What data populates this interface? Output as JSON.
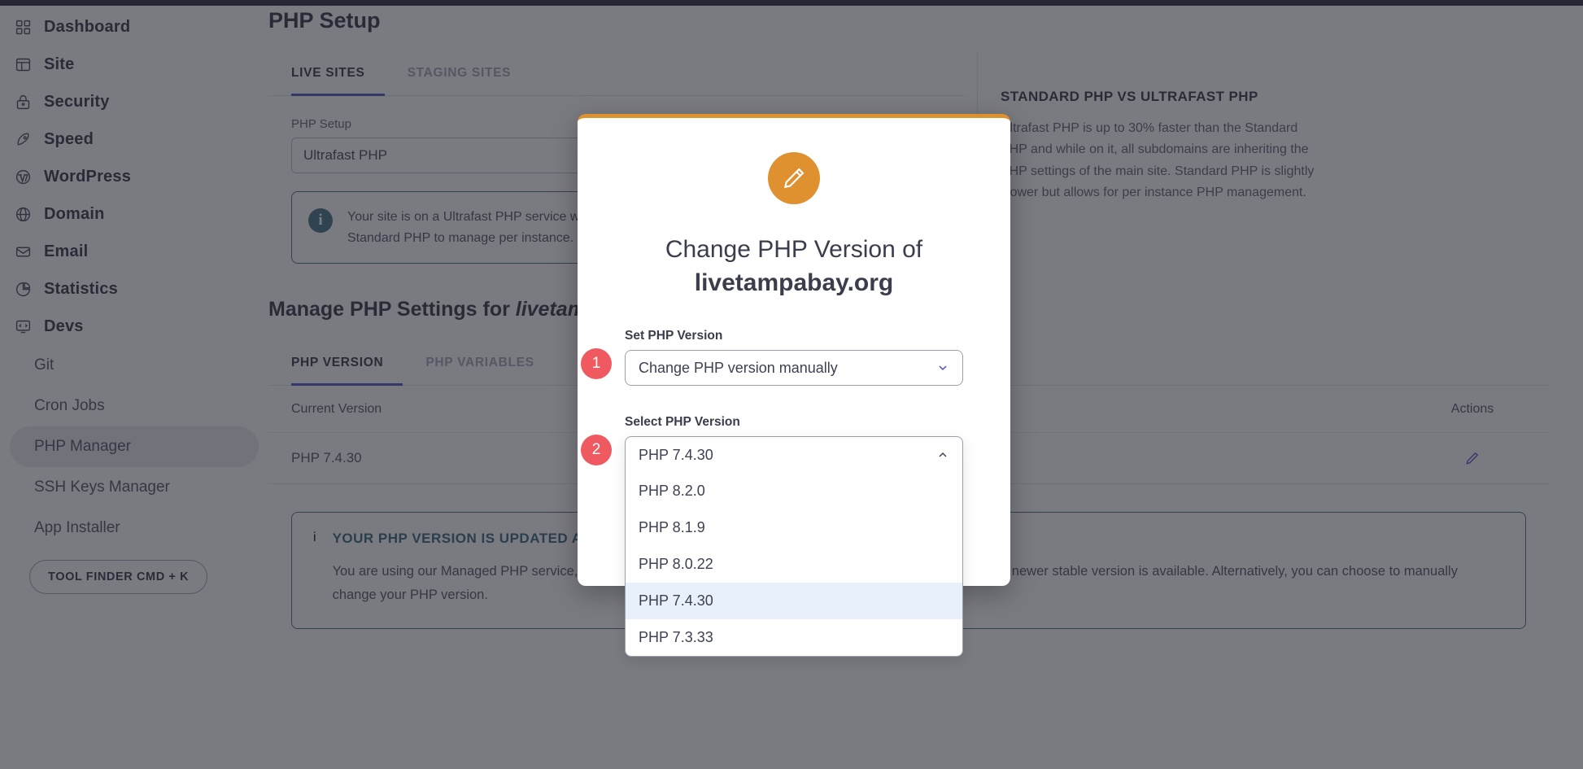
{
  "sidebar": {
    "items": [
      {
        "label": "Dashboard",
        "icon": "grid-icon",
        "type": "main"
      },
      {
        "label": "Site",
        "icon": "site-icon",
        "type": "main"
      },
      {
        "label": "Security",
        "icon": "lock-icon",
        "type": "main"
      },
      {
        "label": "Speed",
        "icon": "rocket-icon",
        "type": "main"
      },
      {
        "label": "WordPress",
        "icon": "wordpress-icon",
        "type": "main"
      },
      {
        "label": "Domain",
        "icon": "globe-icon",
        "type": "main"
      },
      {
        "label": "Email",
        "icon": "envelope-icon",
        "type": "main"
      },
      {
        "label": "Statistics",
        "icon": "pie-chart-icon",
        "type": "main"
      },
      {
        "label": "Devs",
        "icon": "code-monitor-icon",
        "type": "main"
      }
    ],
    "sub_items": [
      {
        "label": "Git",
        "active": false
      },
      {
        "label": "Cron Jobs",
        "active": false
      },
      {
        "label": "PHP Manager",
        "active": true
      },
      {
        "label": "SSH Keys Manager",
        "active": false
      },
      {
        "label": "App Installer",
        "active": false
      }
    ],
    "tool_finder_label": "TOOL FINDER CMD + K"
  },
  "main": {
    "page_title": "PHP Setup",
    "tabs": [
      {
        "label": "LIVE SITES",
        "active": true
      },
      {
        "label": "STAGING SITES",
        "active": false
      }
    ],
    "php_setup_label": "PHP Setup",
    "php_setup_value": "Ultrafast PHP",
    "notice": {
      "icon": "info-icon",
      "text": "Your site is on a Ultrafast PHP service which is applied to your primary site domain. Switch to Standard PHP to manage per instance."
    },
    "right_panel": {
      "title": "STANDARD PHP VS ULTRAFAST PHP",
      "body": "Ultrafast PHP is up to 30% faster than the Standard PHP and while on it, all subdomains are inheriting the PHP settings of the main site. Standard PHP is slightly slower but allows for per instance PHP management."
    },
    "section_title_prefix": "Manage PHP Settings for ",
    "section_title_site": "livetampabay.org",
    "table_tabs": [
      {
        "label": "PHP VERSION",
        "active": true
      },
      {
        "label": "PHP VARIABLES",
        "active": false
      }
    ],
    "table": {
      "headers": [
        "Current Version",
        "Actions"
      ],
      "rows": [
        {
          "version": "PHP 7.4.30",
          "action_icon": "pencil-icon"
        }
      ]
    },
    "bottom_notice": {
      "icon": "info-icon",
      "title": "YOUR PHP VERSION IS UPDATED AUTOMATICALLY",
      "body": "You are using our Managed PHP service, which means that we will automatically update your PHP version once a newer stable version is available. Alternatively, you can choose to manually change your PHP version."
    }
  },
  "modal": {
    "icon": "pencil-icon",
    "title_line1": "Change PHP Version of",
    "title_line2": "livetampabay.org",
    "accent_color": "#e0912f",
    "badge_color": "#ee5a60",
    "set_version": {
      "badge": "1",
      "label": "Set PHP Version",
      "value": "Change PHP version manually",
      "chevron": "chevron-down-icon"
    },
    "select_version": {
      "badge": "2",
      "label": "Select PHP Version",
      "value": "PHP 7.4.30",
      "chevron": "chevron-up-icon",
      "options": [
        {
          "label": "PHP 8.2.0",
          "selected": false
        },
        {
          "label": "PHP 8.1.9",
          "selected": false
        },
        {
          "label": "PHP 8.0.22",
          "selected": false
        },
        {
          "label": "PHP 7.4.30",
          "selected": true
        },
        {
          "label": "PHP 7.3.33",
          "selected": false
        }
      ]
    }
  }
}
